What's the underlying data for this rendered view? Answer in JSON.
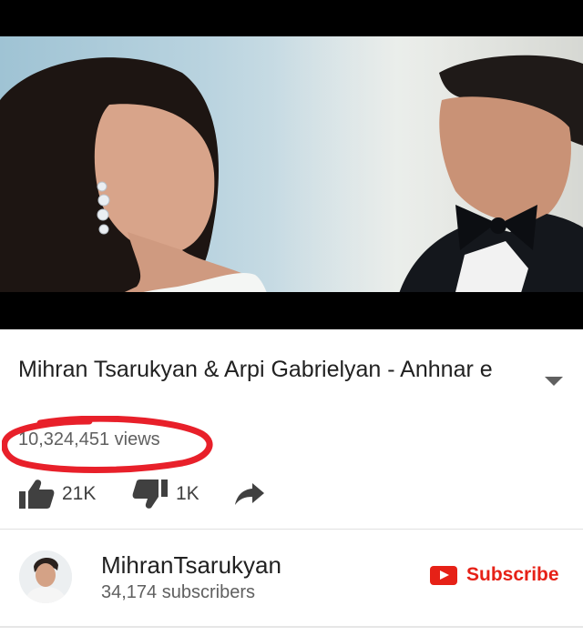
{
  "video": {
    "title": "Mihran Tsarukyan & Arpi Gabrielyan - Anhnar e",
    "views": "10,324,451 views",
    "likes": "21K",
    "dislikes": "1K"
  },
  "channel": {
    "name": "MihranTsarukyan",
    "subscribers": "34,174 subscribers",
    "subscribe_label": "Subscribe"
  },
  "colors": {
    "annotation_circle": "#e8202a",
    "subscribe_red": "#e62117"
  },
  "icons": [
    "thumbs-up-icon",
    "thumbs-down-icon",
    "share-icon",
    "chevron-down-icon",
    "youtube-play-icon"
  ]
}
